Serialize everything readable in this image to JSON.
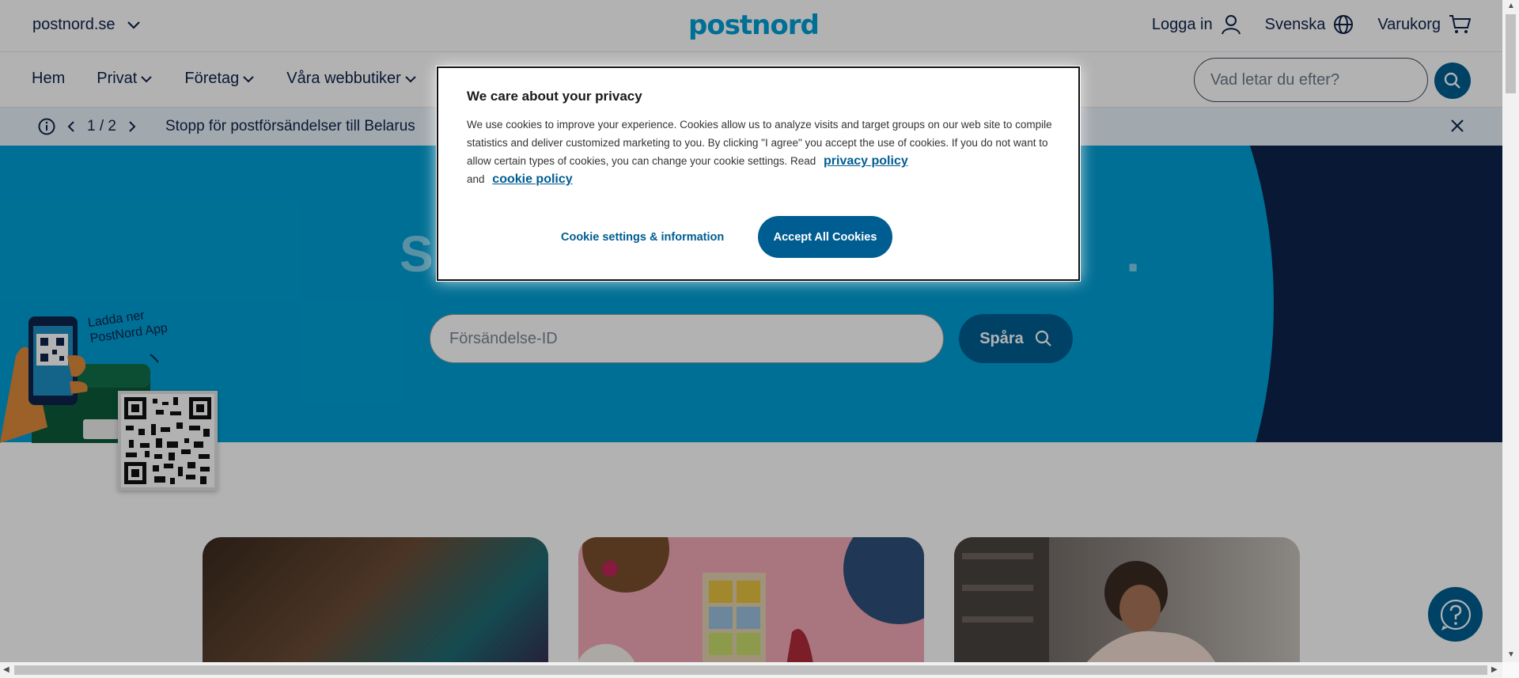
{
  "top": {
    "site": "postnord.se",
    "logo": "postnord",
    "login": "Logga in",
    "language": "Svenska",
    "cart": "Varukorg"
  },
  "nav": {
    "items": [
      {
        "label": "Hem"
      },
      {
        "label": "Privat"
      },
      {
        "label": "Företag"
      },
      {
        "label": "Våra webbutiker"
      }
    ],
    "search_placeholder": "Vad letar du efter?"
  },
  "notice": {
    "pager": "1 / 2",
    "text": "Stopp för postförsändelser till Belarus"
  },
  "hero": {
    "title": "S",
    "title_tail": ".",
    "input_placeholder": "Försändelse-ID",
    "button": "Spåra"
  },
  "app_promo": {
    "text": "Ladda ner PostNord App"
  },
  "cookie": {
    "title": "We care about your privacy",
    "body": "We use cookies to improve your experience. Cookies allow us to analyze visits and target groups on our web site to compile statistics and deliver customized marketing to you. By clicking \"I agree\" you accept the use of cookies. If you do not want to allow certain types of cookies, you can change your cookie settings. Read",
    "privacy_link": "privacy policy",
    "and": "and",
    "cookie_link": "cookie policy",
    "settings_button": "Cookie settings & information",
    "accept_button": "Accept All Cookies"
  },
  "colors": {
    "brand": "#00a0d6",
    "primary": "#005d92",
    "navy": "#0d234b"
  }
}
